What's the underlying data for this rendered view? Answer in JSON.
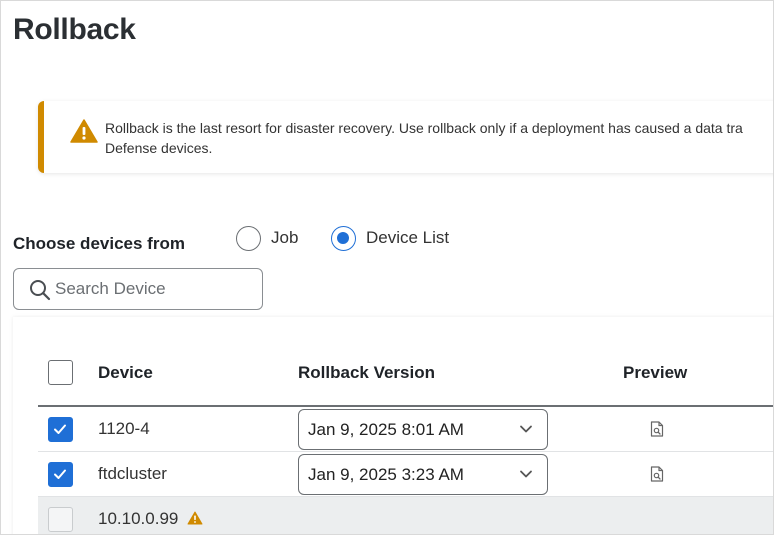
{
  "page": {
    "title": "Rollback"
  },
  "alert": {
    "icon": "warning-icon",
    "text": "Rollback is the last resort for disaster recovery. Use rollback only if a deployment has caused a data tra\nDefense devices."
  },
  "choose": {
    "label": "Choose devices from",
    "options": [
      {
        "label": "Job",
        "selected": false
      },
      {
        "label": "Device List",
        "selected": true
      }
    ]
  },
  "search": {
    "placeholder": "Search Device",
    "value": ""
  },
  "table": {
    "columns": {
      "device": "Device",
      "rollback_version": "Rollback Version",
      "preview": "Preview"
    },
    "rows": [
      {
        "device": "1120-4",
        "checked": true,
        "rollback_version": "Jan 9, 2025 8:01 AM",
        "preview_icon": "file-search-icon"
      },
      {
        "device": "ftdcluster",
        "checked": true,
        "rollback_version": "Jan 9, 2025 3:23 AM",
        "preview_icon": "file-search-icon"
      },
      {
        "device": "10.10.0.99",
        "checked": false,
        "disabled": true,
        "status_icon": "warning-icon"
      }
    ]
  },
  "colors": {
    "accent": "#1f6fd6",
    "warning": "#d08a00",
    "text": "#1f2328"
  }
}
